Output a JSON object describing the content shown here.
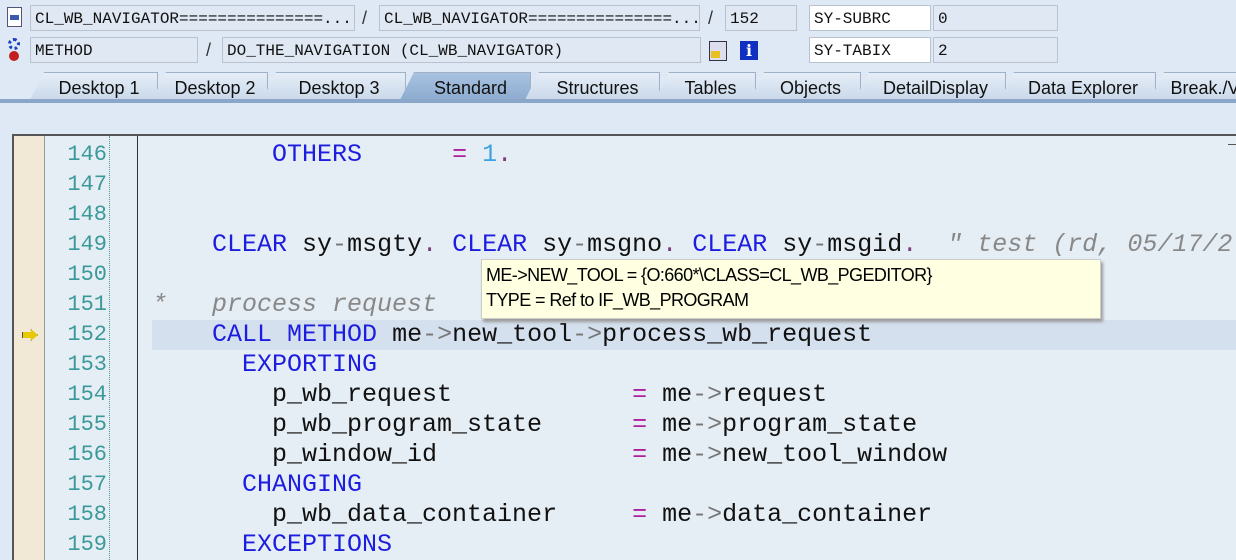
{
  "header": {
    "program": "CL_WB_NAVIGATOR===============...",
    "include": "CL_WB_NAVIGATOR===============...",
    "line": "152",
    "event_type": "METHOD",
    "event": "DO_THE_NAVIGATION (CL_WB_NAVIGATOR)",
    "separator": "/",
    "vars": [
      {
        "name": "SY-SUBRC",
        "value": "0"
      },
      {
        "name": "SY-TABIX",
        "value": "2"
      }
    ]
  },
  "tabs": [
    {
      "label": "Desktop 1",
      "active": false
    },
    {
      "label": "Desktop 2",
      "active": false
    },
    {
      "label": "Desktop 3",
      "active": false
    },
    {
      "label": "Standard",
      "active": true
    },
    {
      "label": "Structures",
      "active": false
    },
    {
      "label": "Tables",
      "active": false
    },
    {
      "label": "Objects",
      "active": false
    },
    {
      "label": "DetailDisplay",
      "active": false
    },
    {
      "label": "Data Explorer",
      "active": false
    },
    {
      "label": "Break./V",
      "active": false
    }
  ],
  "editor": {
    "current_line": "152",
    "lines": [
      {
        "n": "146",
        "tokens": [
          [
            "        ",
            ""
          ],
          [
            "OTHERS",
            "kw"
          ],
          [
            "      ",
            ""
          ],
          [
            "=",
            "op"
          ],
          [
            " ",
            ""
          ],
          [
            "1",
            "num"
          ],
          [
            ".",
            "dot"
          ]
        ]
      },
      {
        "n": "147",
        "tokens": []
      },
      {
        "n": "148",
        "tokens": []
      },
      {
        "n": "149",
        "tokens": [
          [
            "    ",
            ""
          ],
          [
            "CLEAR",
            "kw"
          ],
          [
            " sy",
            ""
          ],
          [
            "-",
            "ar"
          ],
          [
            "msgty",
            ""
          ],
          [
            ".",
            "dot"
          ],
          [
            " ",
            ""
          ],
          [
            "CLEAR",
            "kw"
          ],
          [
            " sy",
            ""
          ],
          [
            "-",
            "ar"
          ],
          [
            "msgno",
            ""
          ],
          [
            ".",
            "dot"
          ],
          [
            " ",
            ""
          ],
          [
            "CLEAR",
            "kw"
          ],
          [
            " sy",
            ""
          ],
          [
            "-",
            "ar"
          ],
          [
            "msgid",
            ""
          ],
          [
            ".",
            "dot"
          ],
          [
            "  \" test (rd, 05/17/2",
            "cm"
          ]
        ]
      },
      {
        "n": "150",
        "tokens": []
      },
      {
        "n": "151",
        "tokens": [
          [
            "*   process request",
            "cm"
          ]
        ]
      },
      {
        "n": "152",
        "tokens": [
          [
            "    ",
            ""
          ],
          [
            "CALL",
            "kw"
          ],
          [
            " ",
            ""
          ],
          [
            "METHOD",
            "kw"
          ],
          [
            " me",
            ""
          ],
          [
            "->",
            "ar"
          ],
          [
            "new_tool",
            ""
          ],
          [
            "->",
            "ar"
          ],
          [
            "process_wb_request",
            ""
          ]
        ]
      },
      {
        "n": "153",
        "tokens": [
          [
            "      ",
            ""
          ],
          [
            "EXPORTING",
            "kw"
          ]
        ]
      },
      {
        "n": "154",
        "tokens": [
          [
            "        p_wb_request            ",
            ""
          ],
          [
            "=",
            "op"
          ],
          [
            " me",
            ""
          ],
          [
            "->",
            "ar"
          ],
          [
            "request",
            ""
          ]
        ]
      },
      {
        "n": "155",
        "tokens": [
          [
            "        p_wb_program_state      ",
            ""
          ],
          [
            "=",
            "op"
          ],
          [
            " me",
            ""
          ],
          [
            "->",
            "ar"
          ],
          [
            "program_state",
            ""
          ]
        ]
      },
      {
        "n": "156",
        "tokens": [
          [
            "        p_window_id             ",
            ""
          ],
          [
            "=",
            "op"
          ],
          [
            " me",
            ""
          ],
          [
            "->",
            "ar"
          ],
          [
            "new_tool_window",
            ""
          ]
        ]
      },
      {
        "n": "157",
        "tokens": [
          [
            "      ",
            ""
          ],
          [
            "CHANGING",
            "kw"
          ]
        ]
      },
      {
        "n": "158",
        "tokens": [
          [
            "        p_wb_data_container     ",
            ""
          ],
          [
            "=",
            "op"
          ],
          [
            " me",
            ""
          ],
          [
            "->",
            "ar"
          ],
          [
            "data_container",
            ""
          ]
        ]
      },
      {
        "n": "159",
        "tokens": [
          [
            "      ",
            ""
          ],
          [
            "EXCEPTIONS",
            "kw"
          ]
        ]
      }
    ]
  },
  "tooltip": {
    "line1": "ME->NEW_TOOL = {O:660*\\CLASS=CL_WB_PGEDITOR}",
    "line2": "TYPE  = Ref to IF_WB_PROGRAM"
  }
}
